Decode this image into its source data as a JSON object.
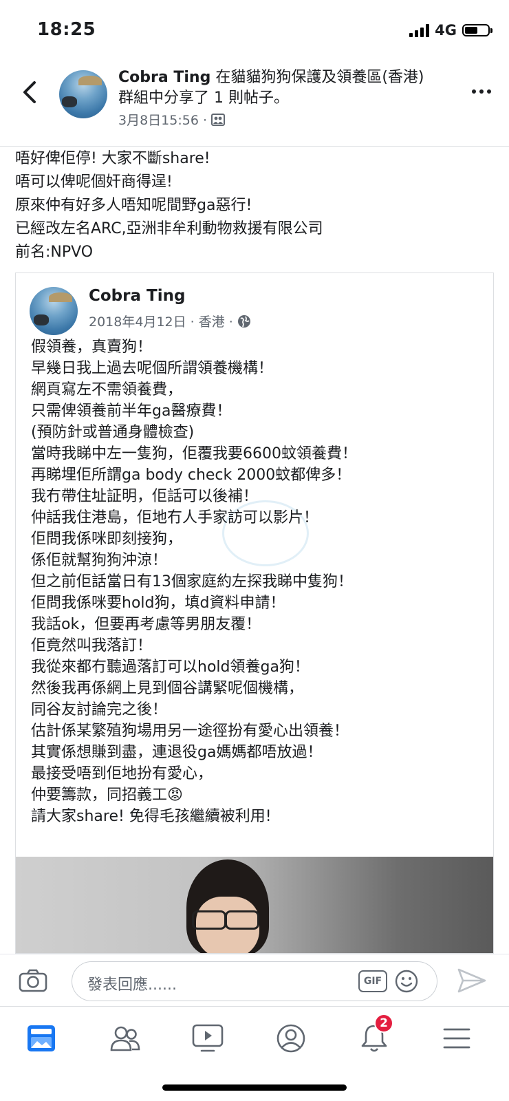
{
  "status_bar": {
    "time": "18:25",
    "network": "4G",
    "battery_level": 0.55
  },
  "post_header": {
    "author": "Cobra Ting",
    "action_text": " 在貓貓狗狗保護及領養區(香港) 群組中分享了 1 則帖子。",
    "date": "3月8日15:56 ·",
    "icons": {
      "back": "back-chevron-icon",
      "audience": "group-audience-icon",
      "more": "more-options-icon"
    }
  },
  "share_text": [
    "唔好俾佢停! 大家不斷share!",
    "唔可以俾呢個奸商得逞!",
    "原來仲有好多人唔知呢間野ga惡行!",
    "已經改左名ARC,亞洲非牟利動物救援有限公司",
    "前名:NPVO"
  ],
  "embedded_post": {
    "author": "Cobra Ting",
    "meta": "2018年4月12日 · 香港 ·",
    "body_lines": [
      "假領養，真賣狗！",
      "早幾日我上過去呢個所謂領養機構！",
      "網頁寫左不需領養費，",
      "只需俾領養前半年ga醫療費！",
      "(預防針或普通身體檢查)",
      "當時我睇中左一隻狗，佢覆我要6600蚊領養費！",
      "再睇埋佢所謂ga body check 2000蚊都俾多！",
      "我冇帶住址証明，佢話可以後補！",
      "仲話我住港島，佢地冇人手家訪可以影片！",
      "佢問我係咪即刻接狗，",
      "係佢就幫狗狗沖涼！",
      "但之前佢話當日有13個家庭約左探我睇中隻狗！",
      "佢問我係咪要hold狗，填d資料申請！",
      "我話ok，但要再考慮等男朋友覆！",
      "佢竟然叫我落訂！",
      "我從來都冇聽過落訂可以hold領養ga狗！",
      "然後我再係網上見到個谷講緊呢個機構，",
      "同谷友討論完之後！",
      "估計係某繁殖狗場用另一途徑扮有愛心出領養！",
      "其實係想賺到盡，連退役ga媽媽都唔放過！",
      "最接受唔到佢地扮有愛心，",
      "仲要籌款，同招義工😡",
      "請大家share! 免得毛孩繼續被利用!"
    ],
    "icons": {
      "globe": "globe-icon",
      "emoji": "angry-face-emoji"
    }
  },
  "comment_bar": {
    "placeholder": "發表回應......",
    "gif_label": "GIF",
    "icons": [
      "camera-icon",
      "gif-icon",
      "smiley-icon",
      "send-icon"
    ]
  },
  "tab_bar": {
    "tabs": [
      {
        "name": "news-feed",
        "icon": "news-feed-icon",
        "active": true
      },
      {
        "name": "groups",
        "icon": "groups-icon"
      },
      {
        "name": "watch",
        "icon": "watch-video-icon"
      },
      {
        "name": "profile",
        "icon": "profile-icon"
      },
      {
        "name": "notifications",
        "icon": "bell-icon",
        "badge": "2"
      },
      {
        "name": "menu",
        "icon": "hamburger-menu-icon"
      }
    ]
  },
  "colors": {
    "accent": "#1877f2",
    "text": "#1c1e21",
    "secondary": "#606770",
    "badge": "#e41e3f"
  }
}
